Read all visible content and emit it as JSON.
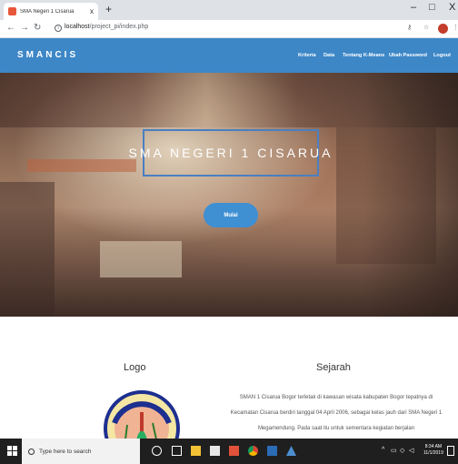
{
  "browser": {
    "tab_title": "SMA Negeri 1 Cisarua",
    "tab_close": "x",
    "new_tab": "+",
    "window_min": "–",
    "window_max": "□",
    "window_close": "X",
    "url_host": "localhost",
    "url_path": "/project_pi/index.php"
  },
  "site": {
    "brand": "SMANCIS",
    "nav": {
      "kriteria": "Kriteria",
      "data": "Data",
      "tentang": "Tentang K-Means",
      "ubah_password": "Ubah Password",
      "logout": "Logout"
    },
    "hero": {
      "title": "SMA NEGERI 1 CISARUA",
      "button": "Mulai"
    },
    "logo_section": {
      "title": "Logo"
    },
    "sejarah_section": {
      "title": "Sejarah",
      "text": "SMAN 1 Cisarua Bogor terletak di kawasan wisata kabupaten Bogor tepatnya di Kecamatan Cisarua berdiri tanggal 04 April 2006, sebagai kelas jauh dari SMA Negeri 1 Megamendung. Pada saat itu untuk sementara kegiatan berjalan"
    }
  },
  "taskbar": {
    "search_placeholder": "Type here to search",
    "time": "8:34 AM",
    "date": "11/1/2019"
  },
  "colors": {
    "nav_bg": "#3d87c7",
    "accent_button": "#3f8fd3",
    "hero_border": "#4a7fc0"
  }
}
